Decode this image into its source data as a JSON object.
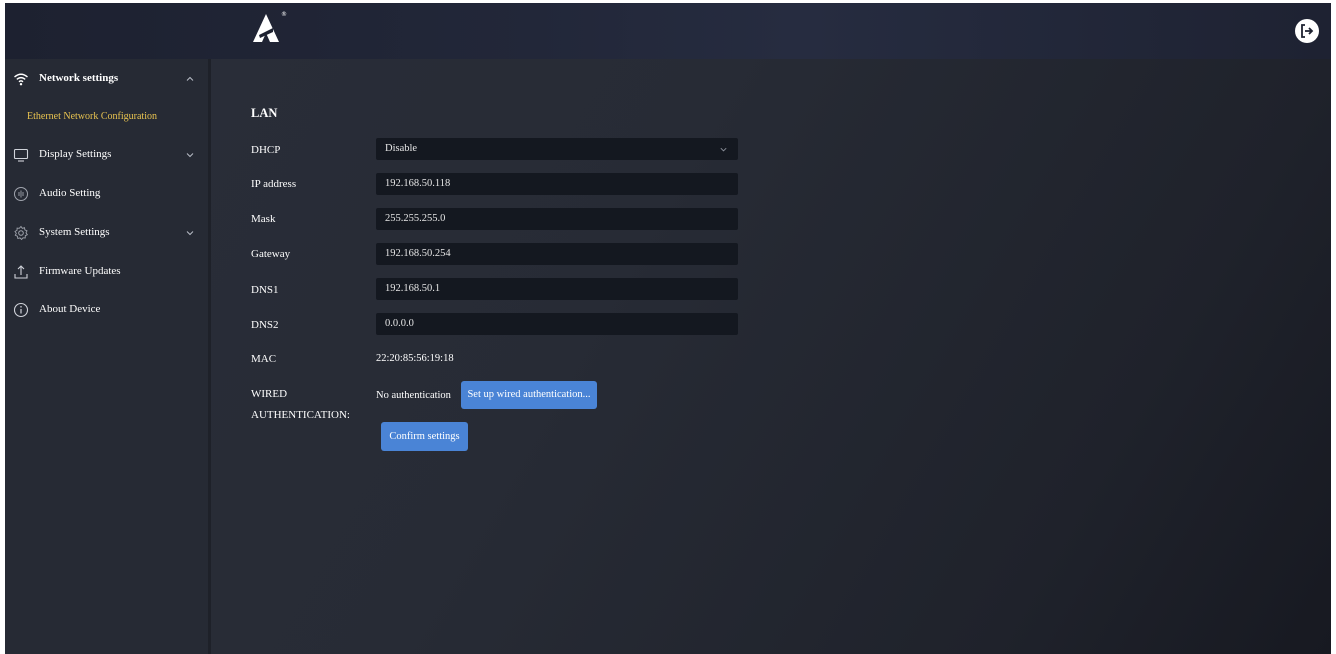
{
  "theme": {
    "accent": "#4a84d6",
    "active_sub": "#e8c350",
    "background": "#262a34"
  },
  "header": {
    "logo_mark": "®",
    "logout_icon": "logout-icon"
  },
  "sidebar": {
    "items": [
      {
        "label": "Network settings",
        "icon": "wifi-icon",
        "expanded": true
      },
      {
        "label": "Ethernet Network Configuration",
        "active": true
      },
      {
        "label": "Display Settings",
        "icon": "monitor-icon"
      },
      {
        "label": "Audio Setting",
        "icon": "audio-icon"
      },
      {
        "label": "System Settings",
        "icon": "gear-icon"
      },
      {
        "label": "Firmware Updates",
        "icon": "upload-icon"
      },
      {
        "label": "About Device",
        "icon": "info-icon"
      }
    ]
  },
  "main": {
    "section_title": "LAN",
    "dhcp": {
      "label": "DHCP",
      "value": "Disable"
    },
    "ip": {
      "label": "IP address",
      "value": "192.168.50.118"
    },
    "mask": {
      "label": "Mask",
      "value": "255.255.255.0"
    },
    "gateway": {
      "label": "Gateway",
      "value": "192.168.50.254"
    },
    "dns1": {
      "label": "DNS1",
      "value": "192.168.50.1"
    },
    "dns2": {
      "label": "DNS2",
      "value": "0.0.0.0"
    },
    "mac": {
      "label": "MAC",
      "value": "22:20:85:56:19:18"
    },
    "wired": {
      "label_line1": "WIRED",
      "label_line2": "AUTHENTICATION:",
      "status": "No authentication",
      "setup_button": "Set up wired authentication..."
    },
    "confirm_button": "Confirm settings"
  }
}
